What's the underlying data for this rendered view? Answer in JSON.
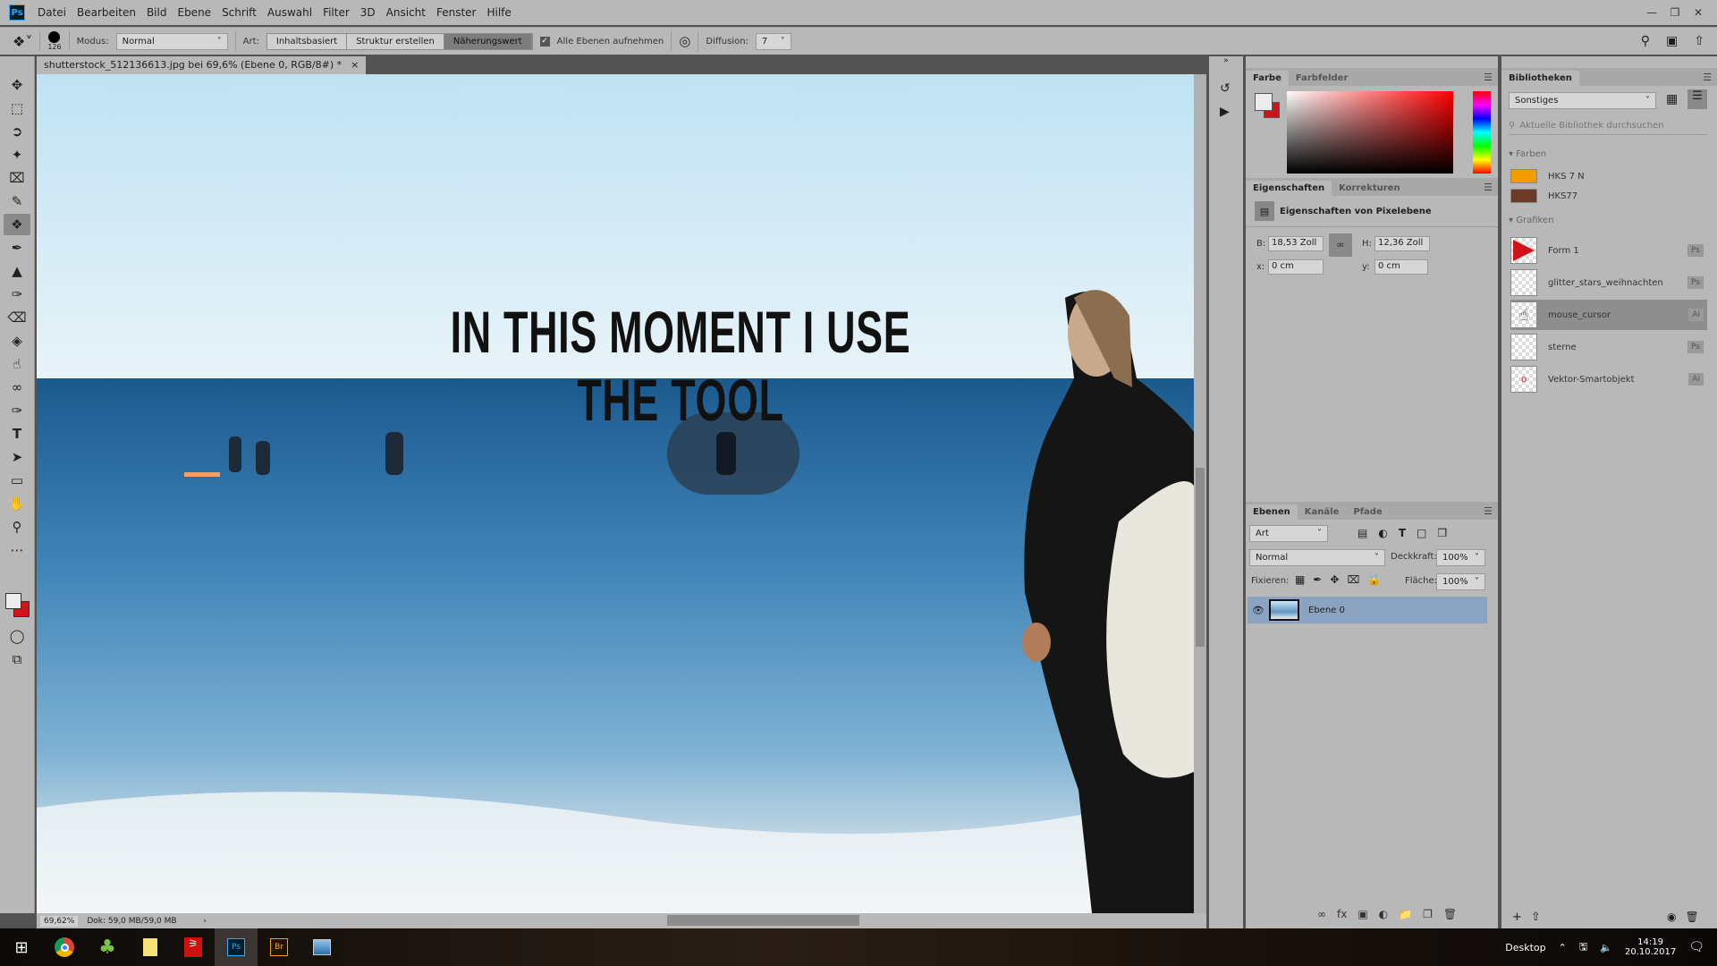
{
  "app": {
    "logo": "Ps",
    "menu": [
      "Datei",
      "Bearbeiten",
      "Bild",
      "Ebene",
      "Schrift",
      "Auswahl",
      "Filter",
      "3D",
      "Ansicht",
      "Fenster",
      "Hilfe"
    ]
  },
  "options": {
    "brush_size": "126",
    "modus_label": "Modus:",
    "modus_value": "Normal",
    "art_label": "Art:",
    "art_options": [
      "Inhaltsbasiert",
      "Struktur erstellen",
      "Näherungswert"
    ],
    "art_selected": "Näherungswert",
    "sample_all_label": "Alle Ebenen aufnehmen",
    "sample_all_checked": true,
    "diffusion_label": "Diffusion:",
    "diffusion_value": "7"
  },
  "document": {
    "tab_title": "shutterstock_512136613.jpg bei 69,6% (Ebene 0, RGB/8#) *",
    "close": "×",
    "overlay_text": "IN THIS MOMENT I USE THE TOOL"
  },
  "status": {
    "zoom": "69,62%",
    "doc": "Dok: 59,0 MB/59,0 MB"
  },
  "color_panel": {
    "tabs": [
      "Farbe",
      "Farbfelder"
    ],
    "foreground": "#ececec",
    "background": "#d0121b"
  },
  "properties": {
    "tabs": [
      "Eigenschaften",
      "Korrekturen"
    ],
    "title": "Eigenschaften von Pixelebene",
    "b_label": "B:",
    "b_value": "18,53 Zoll",
    "h_label": "H:",
    "h_value": "12,36 Zoll",
    "x_label": "x:",
    "x_value": "0 cm",
    "y_label": "y:",
    "y_value": "0 cm"
  },
  "layers": {
    "tabs": [
      "Ebenen",
      "Kanäle",
      "Pfade"
    ],
    "filter": "Art",
    "blend": "Normal",
    "opacity_label": "Deckkraft:",
    "opacity": "100%",
    "lock_label": "Fixieren:",
    "fill_label": "Fläche:",
    "fill": "100%",
    "items": [
      {
        "name": "Ebene 0",
        "visible": true,
        "selected": true
      }
    ]
  },
  "libraries": {
    "tab": "Bibliotheken",
    "library": "Sonstiges",
    "search_placeholder": "Aktuelle Bibliothek durchsuchen",
    "colors_header": "Farben",
    "colors": [
      {
        "name": "HKS 7 N",
        "hex": "#f39c00"
      },
      {
        "name": "HKS77",
        "hex": "#6b3a28"
      }
    ],
    "graphics_header": "Grafiken",
    "graphics": [
      {
        "name": "Form 1",
        "badge": "Ps"
      },
      {
        "name": "glitter_stars_weihnachten",
        "badge": "Ps"
      },
      {
        "name": "mouse_cursor",
        "badge": "Ai"
      },
      {
        "name": "sterne",
        "badge": "Ps"
      },
      {
        "name": "Vektor-Smartobjekt",
        "badge": "Ai"
      }
    ]
  },
  "taskbar": {
    "desktop": "Desktop",
    "time": "14:19",
    "date": "20.10.2017",
    "apps": [
      "windows-start",
      "chrome",
      "clover",
      "sticky-notes",
      "acrobat",
      "photoshop",
      "bridge",
      "photos"
    ]
  }
}
